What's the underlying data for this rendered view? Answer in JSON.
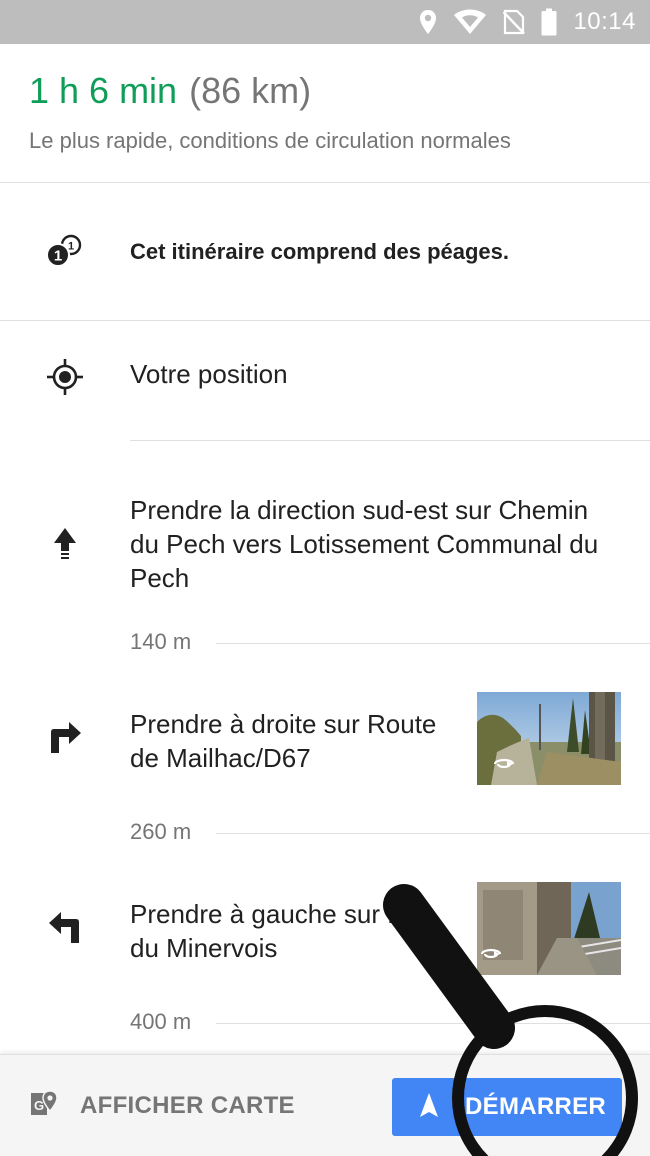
{
  "status_bar": {
    "time": "10:14",
    "icons": [
      "location-icon",
      "wifi-icon",
      "no-sim-icon",
      "battery-icon"
    ]
  },
  "route_summary": {
    "duration": "1 h 6 min",
    "distance": "(86 km)",
    "description": "Le plus rapide, conditions de circulation normales"
  },
  "toll_notice": {
    "text": "Cet itinéraire comprend des péages.",
    "icon": "toll-icon"
  },
  "origin": {
    "label": "Votre position",
    "icon": "my-location-icon"
  },
  "steps": [
    {
      "instruction": "Prendre la direction sud-est sur Chemin du Pech vers Lotissement Communal du Pech",
      "icon": "head-straight-icon",
      "distance": "140 m",
      "has_thumbnail": false
    },
    {
      "instruction": "Prendre à droite sur Route de Mailhac/D67",
      "icon": "turn-right-icon",
      "distance": "260 m",
      "has_thumbnail": true
    },
    {
      "instruction": "Prendre à gauche sur Rue du Minervois",
      "icon": "turn-left-icon",
      "distance": "400 m",
      "has_thumbnail": true
    }
  ],
  "bottom_bar": {
    "show_map_label": "AFFICHER CARTE",
    "start_label": "DÉMARRER"
  },
  "colors": {
    "duration_green": "#0f9d58",
    "start_blue": "#4285f4",
    "status_bar_gray": "#bdbdbd"
  }
}
